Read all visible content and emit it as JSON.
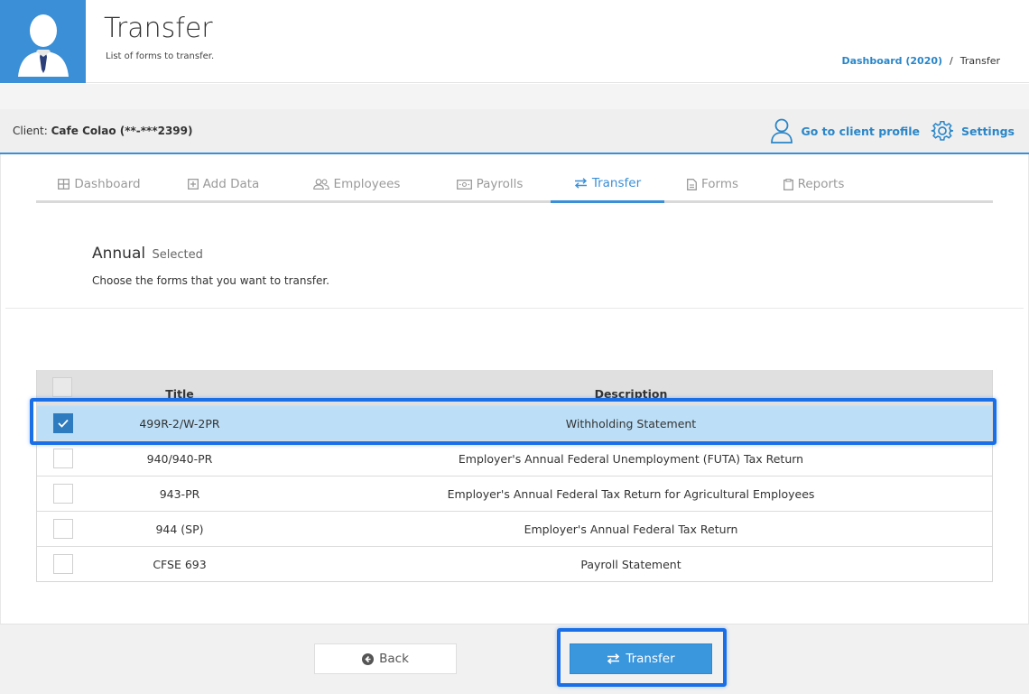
{
  "header": {
    "title": "Transfer",
    "subtitle": "List of forms to transfer.",
    "breadcrumb": {
      "link": "Dashboard (2020)",
      "separator": "/",
      "current": "Transfer"
    }
  },
  "client": {
    "label": "Client:",
    "name": "Cafe Colao (**-***2399)",
    "profile_link": "Go to client profile",
    "settings_link": "Settings"
  },
  "tabs": [
    {
      "label": "Dashboard",
      "icon": "grid-icon"
    },
    {
      "label": "Add Data",
      "icon": "plus-square-icon"
    },
    {
      "label": "Employees",
      "icon": "users-icon"
    },
    {
      "label": "Payrolls",
      "icon": "money-icon"
    },
    {
      "label": "Transfer",
      "icon": "exchange-icon",
      "active": true
    },
    {
      "label": "Forms",
      "icon": "file-icon"
    },
    {
      "label": "Reports",
      "icon": "clipboard-icon"
    }
  ],
  "section": {
    "title": "Annual",
    "title_suffix": "Selected",
    "description": "Choose the forms that you want to transfer."
  },
  "table": {
    "columns": {
      "title": "Title",
      "description": "Description"
    },
    "rows": [
      {
        "title": "499R-2/W-2PR",
        "description": "Withholding Statement",
        "checked": true
      },
      {
        "title": "940/940-PR",
        "description": "Employer's Annual Federal Unemployment (FUTA) Tax Return",
        "checked": false
      },
      {
        "title": "943-PR",
        "description": "Employer's Annual Federal Tax Return for Agricultural Employees",
        "checked": false
      },
      {
        "title": "944 (SP)",
        "description": "Employer's Annual Federal Tax Return",
        "checked": false
      },
      {
        "title": "CFSE 693",
        "description": "Payroll Statement",
        "checked": false
      }
    ]
  },
  "footer": {
    "back_label": "Back",
    "transfer_label": "Transfer"
  },
  "colors": {
    "accent": "#3a8fd6",
    "selected_row": "#bcdff7",
    "highlight": "#1a6fe6"
  }
}
